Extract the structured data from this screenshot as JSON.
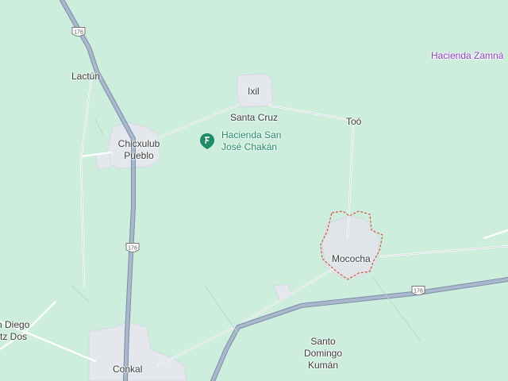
{
  "map": {
    "colors": {
      "land": "#cdeedd",
      "road": "#ffffff",
      "road_outline": "#c5cdd6",
      "highway": "#9fb0c6",
      "highway_outline": "#7d8ea8",
      "town": "#e2e6ea",
      "boundary": "#d9533b",
      "poi": "#1e8a6a",
      "hacienda": "#8e3fc6"
    },
    "places": {
      "lactun": "Lactún",
      "ixil": "Ixil",
      "santa_cruz": "Santa Cruz",
      "too": "Toó",
      "chicxulub_line1": "Chicxulub",
      "chicxulub_line2": "Pueblo",
      "mococha": "Mococha",
      "santo_line1": "Santo",
      "santo_line2": "Domingo",
      "santo_line3": "Kumán",
      "conkal": "Conkal",
      "diego_line1": "n Diego",
      "diego_line2": "tz Dos"
    },
    "pois": {
      "hacienda_line1": "Hacienda San",
      "hacienda_line2": "José Chakán",
      "hacienda_zamna": "Hacienda Zamná",
      "poi_icon": "hacienda-icon"
    },
    "route_shields": [
      {
        "label": "176",
        "icon": "route-shield-icon"
      },
      {
        "label": "176",
        "icon": "route-shield-icon"
      },
      {
        "label": "176",
        "icon": "route-shield-icon"
      }
    ]
  }
}
